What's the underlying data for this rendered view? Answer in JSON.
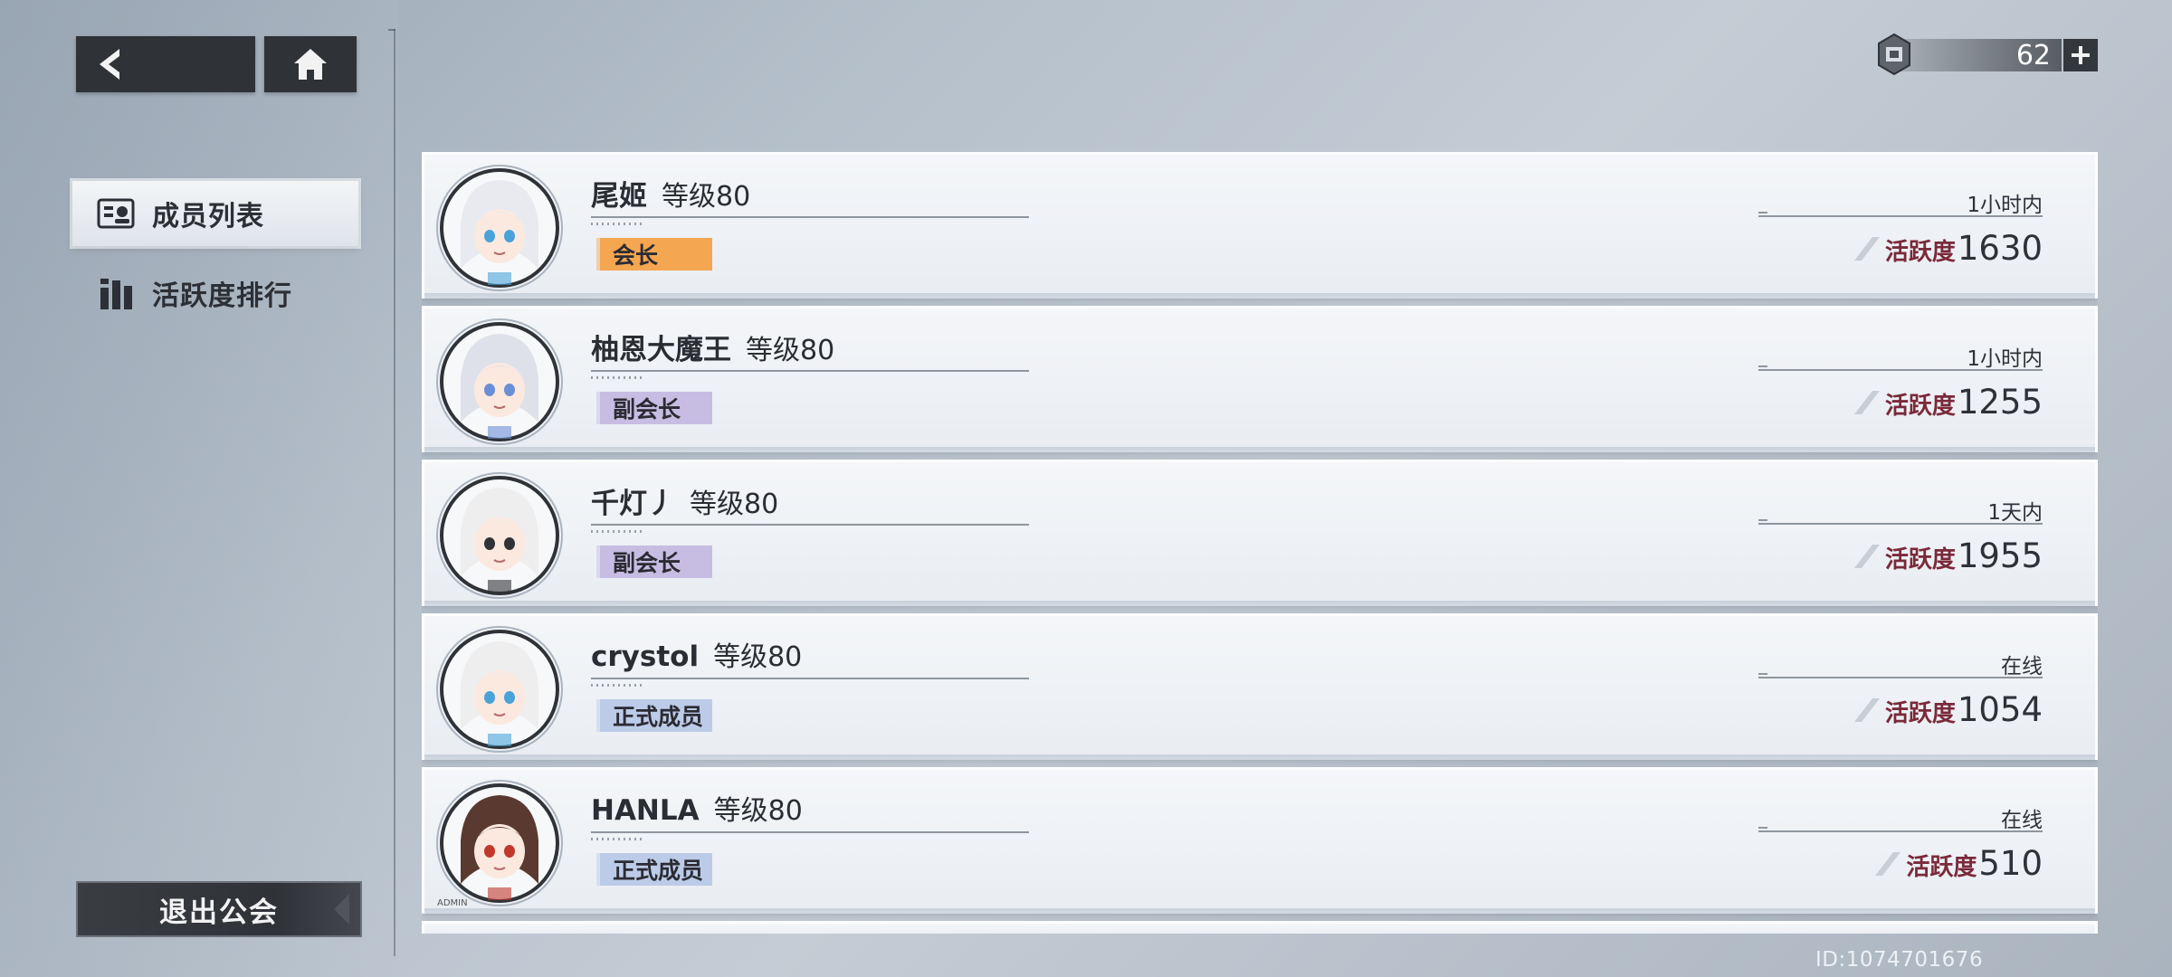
{
  "nav": {
    "items": [
      {
        "label": "成员列表",
        "icon": "member-list-icon",
        "active": true
      },
      {
        "label": "活跃度排行",
        "icon": "ranking-bars-icon",
        "active": false
      }
    ],
    "leave_label": "退出公会"
  },
  "currency": {
    "value": "62",
    "icon": "stamina-device-icon"
  },
  "members": [
    {
      "name": "尾姬",
      "level": "等级80",
      "role": "会长",
      "role_color": "#f4a650",
      "last_online": "1小时内",
      "activity_label": "活跃度",
      "activity_value": "1630",
      "avatar": "avatar-white-hair-blue-eyes",
      "avatar_hair": "#e8eaef",
      "avatar_accent": "#4aa3d8"
    },
    {
      "name": "柚恩大魔王",
      "level": "等级80",
      "role": "副会长",
      "role_color": "#c7bde3",
      "last_online": "1小时内",
      "activity_label": "活跃度",
      "activity_value": "1255",
      "avatar": "avatar-silver-hair-halo",
      "avatar_hair": "#dfe1ea",
      "avatar_accent": "#6b8fd6"
    },
    {
      "name": "千灯丿",
      "level": "等级80",
      "role": "副会长",
      "role_color": "#c7bde3",
      "last_online": "1天内",
      "activity_label": "活跃度",
      "activity_value": "1955",
      "avatar": "avatar-white-hair-butterfly",
      "avatar_hair": "#eeeeee",
      "avatar_accent": "#303236"
    },
    {
      "name": "crystol",
      "level": "等级80",
      "role": "正式成员",
      "role_color": "#bccbe8",
      "last_online": "在线",
      "activity_label": "活跃度",
      "activity_value": "1054",
      "avatar": "avatar-white-hair-butterfly-gold",
      "avatar_hair": "#eeeeee",
      "avatar_accent": "#4aa3d8"
    },
    {
      "name": "HANLA",
      "level": "等级80",
      "role": "正式成员",
      "role_color": "#bccbe8",
      "last_online": "在线",
      "activity_label": "活跃度",
      "activity_value": "510",
      "avatar": "avatar-brown-hair-red-headband",
      "avatar_hair": "#5a3a30",
      "avatar_accent": "#c0392b",
      "avatar_tag": "ADMIN"
    }
  ],
  "player_id": "ID:1074701676"
}
